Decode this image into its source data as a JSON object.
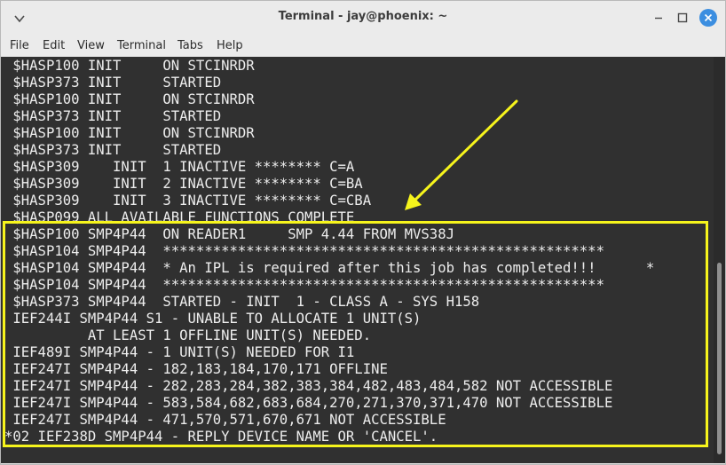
{
  "window": {
    "title": "Terminal - jay@phoenix: ~"
  },
  "menu": {
    "items": [
      "File",
      "Edit",
      "View",
      "Terminal",
      "Tabs",
      "Help"
    ]
  },
  "terminal": {
    "lines": [
      " $HASP100 INIT     ON STCINRDR",
      " $HASP373 INIT     STARTED",
      " $HASP100 INIT     ON STCINRDR",
      " $HASP373 INIT     STARTED",
      " $HASP100 INIT     ON STCINRDR",
      " $HASP373 INIT     STARTED",
      " $HASP309    INIT  1 INACTIVE ******** C=A",
      " $HASP309    INIT  2 INACTIVE ******** C=BA",
      " $HASP309    INIT  3 INACTIVE ******** C=CBA",
      " $HASP099 ALL AVAILABLE FUNCTIONS COMPLETE",
      " $HASP100 SMP4P44  ON READER1     SMP 4.44 FROM MVS38J",
      " $HASP104 SMP4P44  *****************************************************",
      " $HASP104 SMP4P44  * An IPL is required after this job has completed!!!      *",
      " $HASP104 SMP4P44  *****************************************************",
      " $HASP373 SMP4P44  STARTED - INIT  1 - CLASS A - SYS H158",
      " IEF244I SMP4P44 S1 - UNABLE TO ALLOCATE 1 UNIT(S)",
      "          AT LEAST 1 OFFLINE UNIT(S) NEEDED.",
      " IEF489I SMP4P44 - 1 UNIT(S) NEEDED FOR I1",
      " IEF247I SMP4P44 - 182,183,184,170,171 OFFLINE",
      " IEF247I SMP4P44 - 282,283,284,382,383,384,482,483,484,582 NOT ACCESSIBLE",
      " IEF247I SMP4P44 - 583,584,682,683,684,270,271,370,371,470 NOT ACCESSIBLE",
      " IEF247I SMP4P44 - 471,570,571,670,671 NOT ACCESSIBLE",
      "*02 IEF238D SMP4P44 - REPLY DEVICE NAME OR 'CANCEL'."
    ]
  },
  "annotation": {
    "highlight_color": "#f6f41c",
    "arrow_color": "#f6f41c"
  },
  "icons": {
    "menu": "chevron-down-icon",
    "minimize": "minimize-icon",
    "maximize": "maximize-icon",
    "close": "close-icon"
  }
}
